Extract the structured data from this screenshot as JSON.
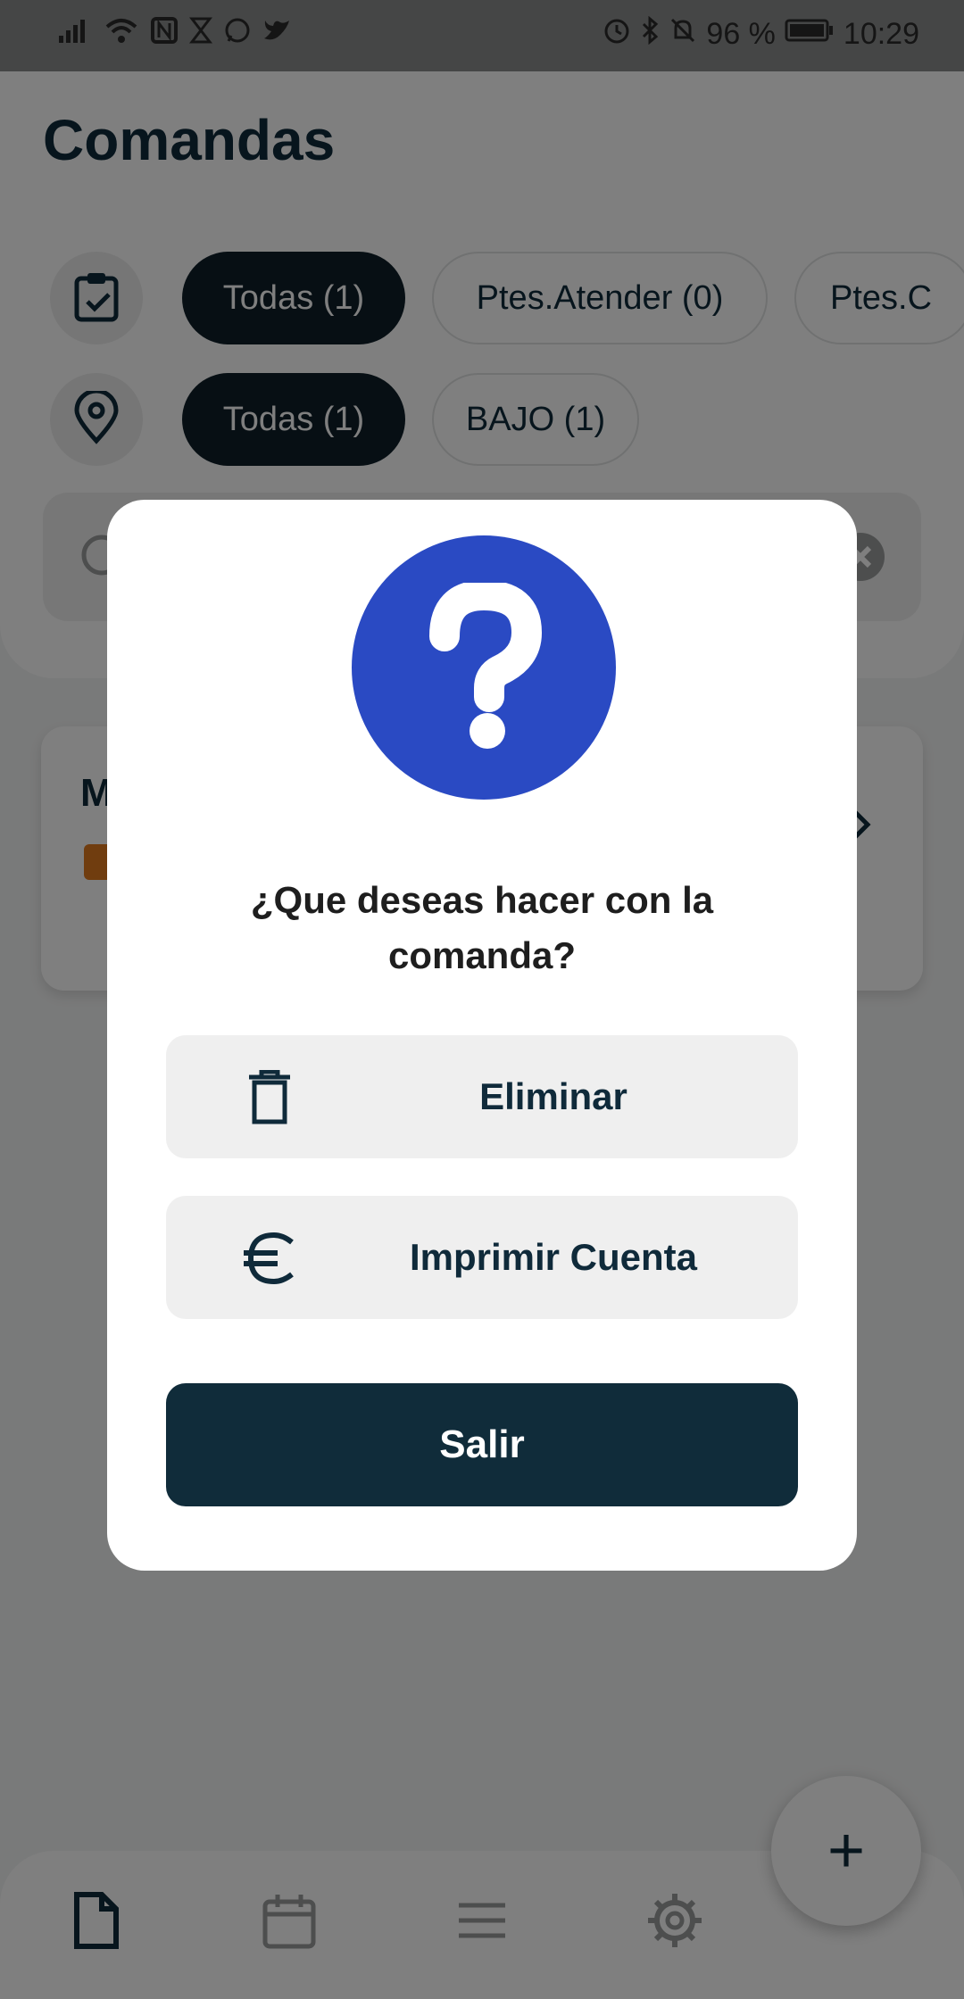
{
  "status_bar": {
    "battery": "96 %",
    "time": "10:29"
  },
  "app": {
    "title": "Comandas",
    "status_filters": [
      "Todas (1)",
      "Ptes.Atender (0)",
      "Ptes.C"
    ],
    "location_filters": [
      "Todas (1)",
      "BAJO (1)"
    ],
    "order_card": {
      "title_initial": "M"
    },
    "fab_label": "+"
  },
  "dialog": {
    "title": "¿Que deseas hacer con la comanda?",
    "delete_label": "Eliminar",
    "print_label": "Imprimir Cuenta",
    "exit_label": "Salir"
  },
  "colors": {
    "primary": "#102c3a",
    "accent_blue": "#2a4ac3",
    "overlay": "rgba(0,0,0,0.5)"
  },
  "icons": [
    "signal-icon",
    "wifi-icon",
    "nfc-icon",
    "hourglass-icon",
    "whatsapp-icon",
    "twitter-icon",
    "alarm-icon",
    "bluetooth-icon",
    "mute-icon",
    "battery-icon",
    "clipboard-check-icon",
    "location-pin-icon",
    "search-icon",
    "clear-icon",
    "chevron-right-icon",
    "document-icon",
    "calendar-icon",
    "menu-icon",
    "gear-icon",
    "question-icon",
    "trash-icon",
    "euro-icon"
  ]
}
